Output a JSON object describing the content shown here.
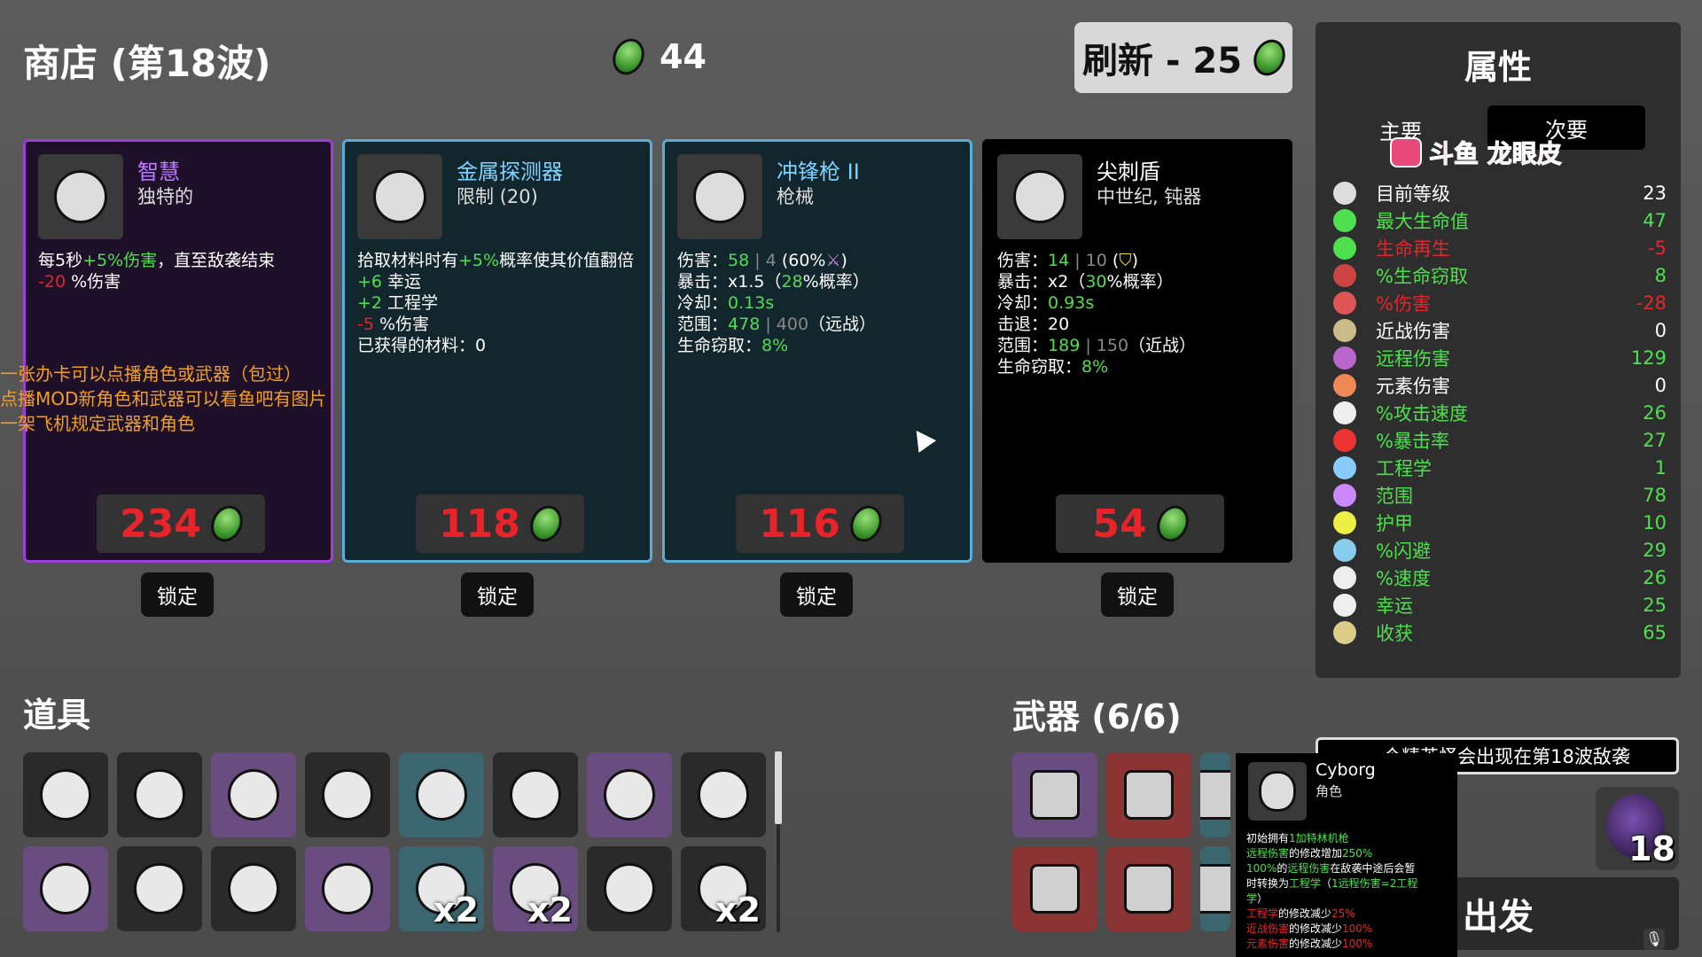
{
  "header": {
    "shop_title": "商店 (第18波)",
    "materials": "44",
    "refresh_label": "刷新 - 25"
  },
  "cards": [
    {
      "name": "智慧",
      "name_color": "#c07cff",
      "sub": "独特的",
      "border": "#9d3fd8",
      "bg": "#1f1029",
      "icon": "wise-bird-icon",
      "lines": [
        [
          [
            "每5秒",
            ""
          ],
          [
            "+5%伤害",
            "g"
          ],
          [
            "，直至敌袭结束",
            ""
          ]
        ],
        [
          [
            "-20",
            "r"
          ],
          [
            " %伤害",
            ""
          ]
        ]
      ],
      "price": "234"
    },
    {
      "name": "金属探测器",
      "name_color": "#7fd3ff",
      "sub": "限制 (20)",
      "border": "#5aaed6",
      "bg": "#12262e",
      "icon": "metal-detector-icon",
      "lines": [
        [
          [
            "拾取材料时有",
            ""
          ],
          [
            "+5%",
            "g"
          ],
          [
            "概率使其价值翻倍",
            ""
          ]
        ],
        [
          [
            "+6",
            "g"
          ],
          [
            " 幸运",
            ""
          ]
        ],
        [
          [
            "+2",
            "g"
          ],
          [
            " 工程学",
            ""
          ]
        ],
        [
          [
            "-5",
            "r"
          ],
          [
            " %伤害",
            ""
          ]
        ],
        [
          [
            "已获得的材料：0",
            ""
          ]
        ]
      ],
      "price": "118"
    },
    {
      "name": "冲锋枪 II",
      "name_color": "#7fd3ff",
      "sub": "枪械",
      "border": "#5aaed6",
      "bg": "#12262e",
      "icon": "smg-icon",
      "lines": [
        [
          [
            "伤害：",
            ""
          ],
          [
            "58",
            "g"
          ],
          [
            " | 4 ",
            "gr"
          ],
          [
            "(60%",
            ""
          ],
          [
            "⚔",
            "pu"
          ],
          [
            ")",
            ""
          ]
        ],
        [
          [
            "暴击：x1.5（",
            ""
          ],
          [
            "28",
            "g"
          ],
          [
            "%概率）",
            ""
          ]
        ],
        [
          [
            "冷却：",
            ""
          ],
          [
            "0.13s",
            "g"
          ]
        ],
        [
          [
            "范围：",
            ""
          ],
          [
            "478",
            "g"
          ],
          [
            " | 400",
            "gr"
          ],
          [
            "（远战）",
            ""
          ]
        ],
        [
          [
            "生命窃取：",
            ""
          ],
          [
            "8%",
            "g"
          ]
        ]
      ],
      "price": "116"
    },
    {
      "name": "尖刺盾",
      "name_color": "#ffffff",
      "sub": "中世纪, 钝器",
      "border": "#000000",
      "bg": "#000000",
      "icon": "spiked-shield-icon",
      "lines": [
        [
          [
            "伤害：",
            ""
          ],
          [
            "14",
            "g"
          ],
          [
            " | 10 ",
            "gr"
          ],
          [
            "(",
            ""
          ],
          [
            "⛉",
            "ye"
          ],
          [
            ")",
            ""
          ]
        ],
        [
          [
            "暴击：x2（",
            ""
          ],
          [
            "30",
            "g"
          ],
          [
            "%概率）",
            ""
          ]
        ],
        [
          [
            "冷却：",
            ""
          ],
          [
            "0.93s",
            "g"
          ]
        ],
        [
          [
            "击退：20",
            ""
          ]
        ],
        [
          [
            "范围：",
            ""
          ],
          [
            "189",
            "g"
          ],
          [
            " | 150",
            "gr"
          ],
          [
            "（近战）",
            ""
          ]
        ],
        [
          [
            "生命窃取：",
            ""
          ],
          [
            "8%",
            "g"
          ]
        ]
      ],
      "price": "54"
    }
  ],
  "lock_label": "锁定",
  "overlay": {
    "lines": [
      "一张办卡可以点播角色或武器（包过）",
      "点播MOD新角色和武器可以看鱼吧有图片",
      "一架飞机规定武器和角色"
    ],
    "watermark": "斗鱼 龙眼皮"
  },
  "stats": {
    "title": "属性",
    "tab_primary": "主要",
    "tab_secondary": "次要",
    "rows": [
      {
        "label": "目前等级",
        "value": "23",
        "color": "#ffffff",
        "vcolor": "#ffffff",
        "icon": "level-icon",
        "ic": "#ddd"
      },
      {
        "label": "最大生命值",
        "value": "47",
        "color": "#4ee04e",
        "vcolor": "#4ee04e",
        "icon": "heart-icon",
        "ic": "#4ee04e"
      },
      {
        "label": "生命再生",
        "value": "-5",
        "color": "#e8242a",
        "vcolor": "#e8242a",
        "icon": "regen-icon",
        "ic": "#4ee04e"
      },
      {
        "label": "%生命窃取",
        "value": "8",
        "color": "#4ee04e",
        "vcolor": "#4ee04e",
        "icon": "lifesteal-icon",
        "ic": "#c44"
      },
      {
        "label": "%伤害",
        "value": "-28",
        "color": "#e8242a",
        "vcolor": "#e8242a",
        "icon": "damage-icon",
        "ic": "#d55"
      },
      {
        "label": "近战伤害",
        "value": "0",
        "color": "#ffffff",
        "vcolor": "#ffffff",
        "icon": "melee-icon",
        "ic": "#cb8"
      },
      {
        "label": "远程伤害",
        "value": "129",
        "color": "#4ee04e",
        "vcolor": "#4ee04e",
        "icon": "ranged-icon",
        "ic": "#b6c"
      },
      {
        "label": "元素伤害",
        "value": "0",
        "color": "#ffffff",
        "vcolor": "#ffffff",
        "icon": "elemental-icon",
        "ic": "#e85"
      },
      {
        "label": "%攻击速度",
        "value": "26",
        "color": "#4ee04e",
        "vcolor": "#4ee04e",
        "icon": "attack-speed-icon",
        "ic": "#eee"
      },
      {
        "label": "%暴击率",
        "value": "27",
        "color": "#4ee04e",
        "vcolor": "#4ee04e",
        "icon": "crit-icon",
        "ic": "#e33"
      },
      {
        "label": "工程学",
        "value": "1",
        "color": "#4ee04e",
        "vcolor": "#4ee04e",
        "icon": "engineering-icon",
        "ic": "#8cf"
      },
      {
        "label": "范围",
        "value": "78",
        "color": "#4ee04e",
        "vcolor": "#4ee04e",
        "icon": "range-icon",
        "ic": "#c8f"
      },
      {
        "label": "护甲",
        "value": "10",
        "color": "#4ee04e",
        "vcolor": "#4ee04e",
        "icon": "armor-icon",
        "ic": "#ee4"
      },
      {
        "label": "%闪避",
        "value": "29",
        "color": "#4ee04e",
        "vcolor": "#4ee04e",
        "icon": "dodge-icon",
        "ic": "#8ce"
      },
      {
        "label": "%速度",
        "value": "26",
        "color": "#4ee04e",
        "vcolor": "#4ee04e",
        "icon": "speed-icon",
        "ic": "#eee"
      },
      {
        "label": "幸运",
        "value": "25",
        "color": "#4ee04e",
        "vcolor": "#4ee04e",
        "icon": "luck-icon",
        "ic": "#eee"
      },
      {
        "label": "收获",
        "value": "65",
        "color": "#4ee04e",
        "vcolor": "#4ee04e",
        "icon": "harvest-icon",
        "ic": "#dc8"
      }
    ]
  },
  "items": {
    "title": "道具",
    "slots": [
      {
        "icon": "tongue-icon",
        "bg": "blk",
        "count": ""
      },
      {
        "icon": "cyborg-head-icon",
        "bg": "blk",
        "count": ""
      },
      {
        "icon": "wings-icon",
        "bg": "pur",
        "count": ""
      },
      {
        "icon": "ghost-icon",
        "bg": "blk",
        "count": ""
      },
      {
        "icon": "turret-icon",
        "bg": "tea",
        "count": ""
      },
      {
        "icon": "helmet-icon",
        "bg": "blk",
        "count": ""
      },
      {
        "icon": "skull-explosion-icon",
        "bg": "pur",
        "count": ""
      },
      {
        "icon": "mask-icon",
        "bg": "blk",
        "count": ""
      },
      {
        "icon": "robot-legs-icon",
        "bg": "pur",
        "count": ""
      },
      {
        "icon": "potion-cup-icon",
        "bg": "blk",
        "count": ""
      },
      {
        "icon": "butterfly-icon",
        "bg": "blk",
        "count": ""
      },
      {
        "icon": "mushroom-icon",
        "bg": "pur",
        "count": ""
      },
      {
        "icon": "scope-icon",
        "bg": "tea",
        "count": "x2"
      },
      {
        "icon": "blade-icon",
        "bg": "pur",
        "count": "x2"
      },
      {
        "icon": "egg-icon",
        "bg": "blk",
        "count": ""
      },
      {
        "icon": "hedgehog-icon",
        "bg": "blk",
        "count": "x2"
      }
    ]
  },
  "weapons": {
    "title": "武器 (6/6)",
    "slots": [
      {
        "icon": "minigun-icon",
        "bg": "pur"
      },
      {
        "icon": "wrench-icon",
        "bg": "red"
      },
      {
        "icon": "wrench-icon",
        "bg": "tea"
      },
      {
        "icon": "wrench-icon",
        "bg": "red"
      },
      {
        "icon": "smg-icon",
        "bg": "red"
      },
      {
        "icon": "smg-icon",
        "bg": "tea"
      }
    ]
  },
  "elite_banner": "一个精英怪会出现在第18波敌袭",
  "wave_badge": "18",
  "go_label": "出发",
  "tooltip": {
    "name": "Cyborg",
    "type": "角色",
    "lines": [
      [
        [
          "初始拥有",
          ""
        ],
        [
          "1加特林机枪",
          "g"
        ]
      ],
      [
        [
          "远程伤害",
          "g"
        ],
        [
          "的修改增加",
          ""
        ],
        [
          "250%",
          "g"
        ]
      ],
      [
        [
          "100%",
          "g"
        ],
        [
          "的",
          ""
        ],
        [
          "远程伤害",
          "g"
        ],
        [
          "在敌袭中途后会暂",
          ""
        ]
      ],
      [
        [
          "时转换为",
          ""
        ],
        [
          "工程学",
          "g"
        ],
        [
          "（",
          ""
        ],
        [
          "1远程伤害=2工程",
          "g"
        ]
      ],
      [
        [
          "学",
          "g"
        ],
        [
          "）",
          ""
        ]
      ],
      [
        [
          "工程学",
          "r"
        ],
        [
          "的修改减少",
          ""
        ],
        [
          "25%",
          "r"
        ]
      ],
      [
        [
          "近战伤害",
          "r"
        ],
        [
          "的修改减少",
          ""
        ],
        [
          "100%",
          "r"
        ]
      ],
      [
        [
          "元素伤害",
          "r"
        ],
        [
          "的修改减少",
          ""
        ],
        [
          "100%",
          "r"
        ]
      ]
    ]
  }
}
